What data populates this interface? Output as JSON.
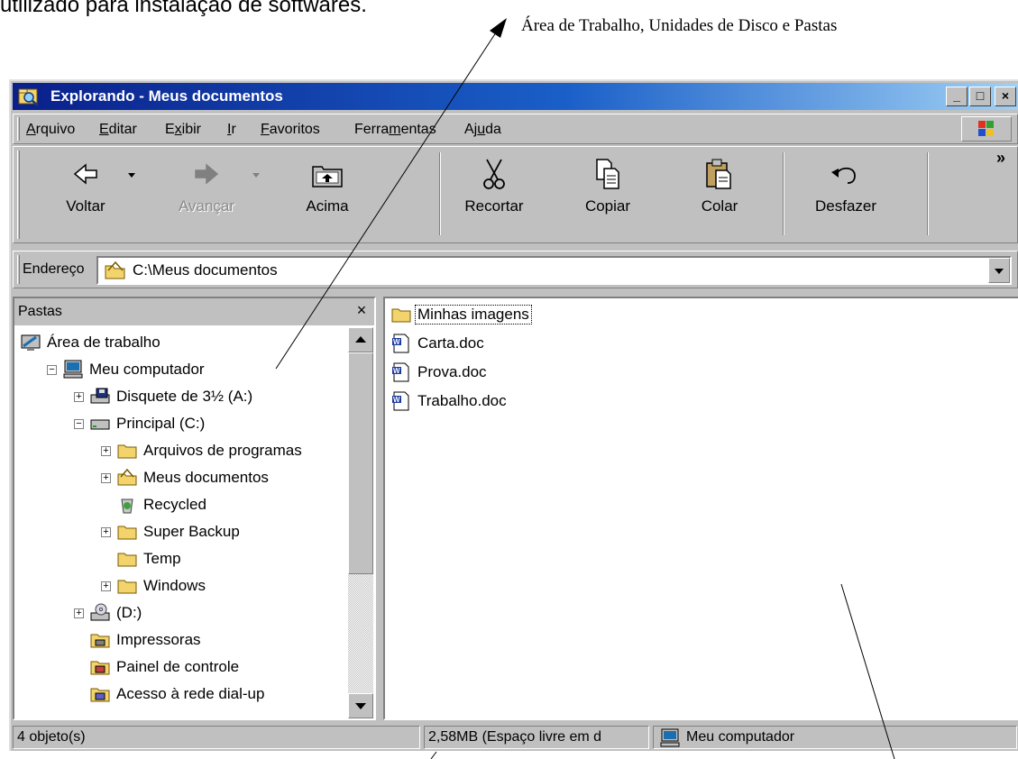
{
  "page_text": "utilizado para instalação de softwares.",
  "annotation": "Área de Trabalho, Unidades de Disco e Pastas",
  "window": {
    "title": "Explorando - Meus documentos",
    "minimize": "_",
    "maximize": "□",
    "close": "×"
  },
  "menu": [
    {
      "label": "Arquivo",
      "accel": "A"
    },
    {
      "label": "Editar",
      "accel": "E"
    },
    {
      "label": "Exibir",
      "accel": "x"
    },
    {
      "label": "Ir",
      "accel": "I"
    },
    {
      "label": "Favoritos",
      "accel": "F"
    },
    {
      "label": "Ferramentas",
      "accel": "m"
    },
    {
      "label": "Ajuda",
      "accel": "u"
    }
  ],
  "toolbar": {
    "back": "Voltar",
    "forward": "Avançar",
    "up": "Acima",
    "cut": "Recortar",
    "copy": "Copiar",
    "paste": "Colar",
    "undo": "Desfazer",
    "more": "»"
  },
  "address": {
    "label": "Endereço",
    "value": "C:\\Meus documentos"
  },
  "folders_pane": {
    "title": "Pastas",
    "close": "×",
    "tree": [
      {
        "label": "Área de trabalho",
        "icon": "desktop-icon",
        "level": 0,
        "expander": ""
      },
      {
        "label": "Meu computador",
        "icon": "computer-icon",
        "level": 1,
        "expander": "−"
      },
      {
        "label": "Disquete de 3½ (A:)",
        "icon": "floppy-drive-icon",
        "level": 2,
        "expander": "+"
      },
      {
        "label": "Principal (C:)",
        "icon": "hard-drive-icon",
        "level": 2,
        "expander": "−"
      },
      {
        "label": "Arquivos de programas",
        "icon": "folder-icon",
        "level": 3,
        "expander": "+"
      },
      {
        "label": "Meus documentos",
        "icon": "my-documents-folder-icon",
        "level": 3,
        "expander": "+"
      },
      {
        "label": "Recycled",
        "icon": "recycle-bin-icon",
        "level": 3,
        "expander": ""
      },
      {
        "label": "Super Backup",
        "icon": "folder-icon",
        "level": 3,
        "expander": "+"
      },
      {
        "label": "Temp",
        "icon": "folder-icon",
        "level": 3,
        "expander": ""
      },
      {
        "label": "Windows",
        "icon": "folder-icon",
        "level": 3,
        "expander": "+"
      },
      {
        "label": "(D:)",
        "icon": "cd-drive-icon",
        "level": 2,
        "expander": "+"
      },
      {
        "label": "Impressoras",
        "icon": "printers-folder-icon",
        "level": 2,
        "expander": ""
      },
      {
        "label": "Painel de controle",
        "icon": "control-panel-icon",
        "level": 2,
        "expander": ""
      },
      {
        "label": "Acesso à rede dial-up",
        "icon": "dialup-network-icon",
        "level": 2,
        "expander": ""
      }
    ]
  },
  "files": [
    {
      "name": "Minhas imagens",
      "icon": "folder-icon",
      "focused": true
    },
    {
      "name": "Carta.doc",
      "icon": "word-document-icon",
      "focused": false
    },
    {
      "name": "Prova.doc",
      "icon": "word-document-icon",
      "focused": false
    },
    {
      "name": "Trabalho.doc",
      "icon": "word-document-icon",
      "focused": false
    }
  ],
  "status": {
    "objects": "4 objeto(s)",
    "free_space": "2,58MB (Espaço livre em d",
    "location": "Meu computador"
  },
  "colors": {
    "titlebar_start": "#0a1f8a",
    "titlebar_end": "#9fd0f5",
    "face": "#c0c0c0"
  }
}
